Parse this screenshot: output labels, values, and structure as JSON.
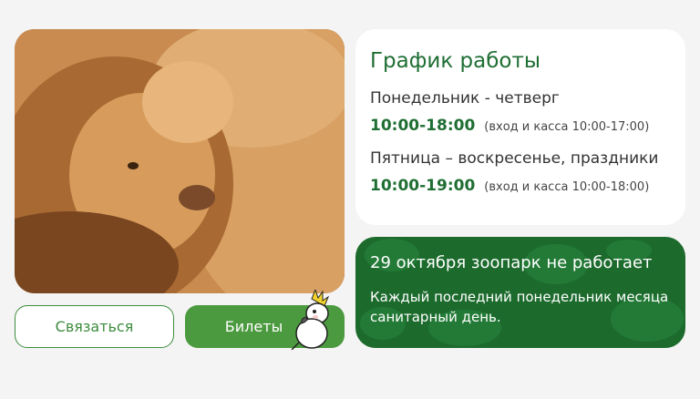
{
  "photo": {
    "alt": "lions"
  },
  "buttons": {
    "contact": "Связаться",
    "tickets": "Билеты"
  },
  "hours": {
    "title": "График работы",
    "schedule": [
      {
        "days": "Понедельник - четверг",
        "time": "10:00-18:00",
        "note": "(вход и касса 10:00-17:00)"
      },
      {
        "days": "Пятница – воскресенье, праздники",
        "time": "10:00-19:00",
        "note": "(вход и касса 10:00-18:00)"
      }
    ]
  },
  "notice": {
    "title": "29 октября зоопарк не работает",
    "text": "Каждый последний понедельник месяца санитарный день."
  },
  "colors": {
    "accent": "#1f6e33",
    "button_green": "#4c9a3f",
    "notice_bg": "#1c6b2d",
    "page_bg": "#f4f4f4"
  }
}
